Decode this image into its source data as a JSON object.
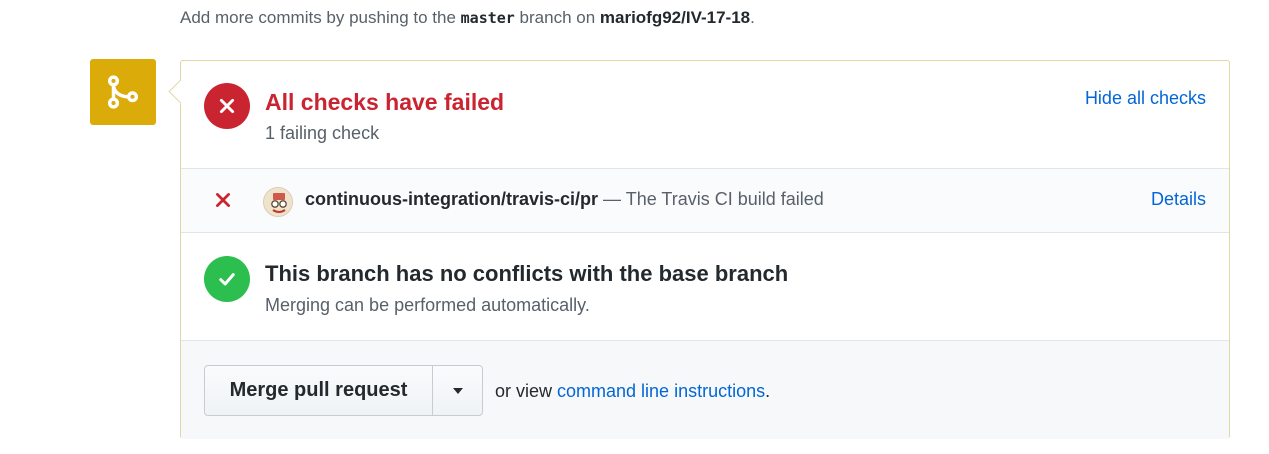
{
  "hint": {
    "prefix": "Add more commits by pushing to the ",
    "branch": "master",
    "middle": " branch on ",
    "repo": "mariofg92/IV-17-18",
    "suffix": "."
  },
  "status": {
    "title": "All checks have failed",
    "subtitle": "1 failing check",
    "hide_link": "Hide all checks"
  },
  "check": {
    "context": "continuous-integration/travis-ci/pr",
    "description": " — The Travis CI build failed",
    "details_link": "Details"
  },
  "conflicts": {
    "title": "This branch has no conflicts with the base branch",
    "subtitle": "Merging can be performed automatically."
  },
  "merge": {
    "button_label": "Merge pull request",
    "alt_prefix": "or view ",
    "alt_link": "command line instructions",
    "alt_suffix": "."
  },
  "colors": {
    "fail": "#cb2431",
    "success": "#2cbe4e",
    "merge_icon_bg": "#dbab09",
    "link": "#0366d6"
  },
  "icons": {
    "merge": "git-merge-icon",
    "fail": "x-icon",
    "success": "check-icon",
    "caret": "triangle-down-icon"
  }
}
